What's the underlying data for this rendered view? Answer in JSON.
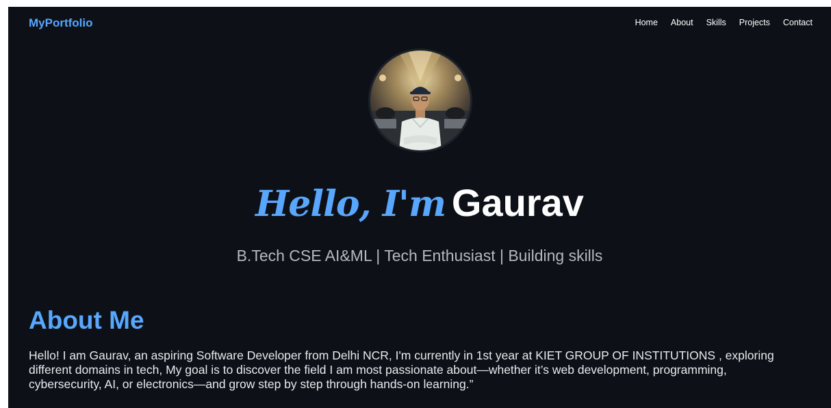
{
  "navbar": {
    "brand": "MyPortfolio",
    "links": [
      "Home",
      "About",
      "Skills",
      "Projects",
      "Contact"
    ]
  },
  "hero": {
    "greeting": "Hello, I'm",
    "name": "Gaurav",
    "tagline": "B.Tech CSE AI&ML | Tech Enthusiast | Building skills"
  },
  "about": {
    "heading": "About Me",
    "text": "Hello! I am Gaurav, an aspiring Software Developer from Delhi NCR, I'm currently in 1st year at KIET GROUP OF INSTITUTIONS , exploring different domains in tech, My goal is to discover the field I am most passionate about—whether it’s web development, programming, cybersecurity, AI, or electronics—and grow step by step through hands-on learning.”"
  },
  "colors": {
    "background": "#0d1117",
    "accent": "#58a6ff",
    "text": "#ffffff",
    "muted": "#b4b9c0"
  }
}
